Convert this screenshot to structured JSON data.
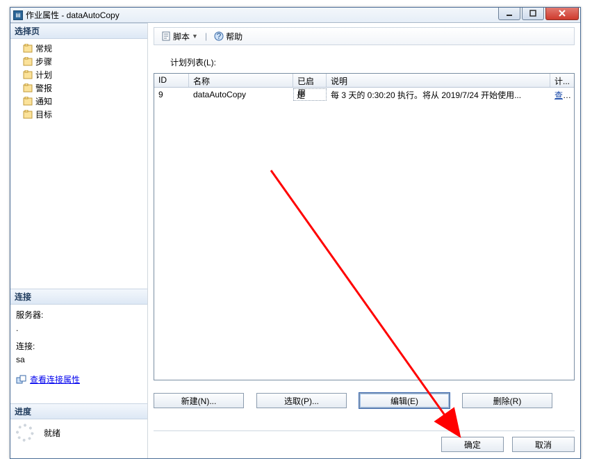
{
  "window": {
    "title": "作业属性 - dataAutoCopy"
  },
  "leftPanel": {
    "selectPageHeader": "选择页",
    "pages": [
      "常规",
      "步骤",
      "计划",
      "警报",
      "通知",
      "目标"
    ],
    "connectionHeader": "连接",
    "serverLabel": "服务器:",
    "serverValue": ".",
    "connectLabel": "连接:",
    "connectValue": "sa",
    "viewConnPropsLink": "查看连接属性",
    "progressHeader": "进度",
    "progressStatus": "就绪"
  },
  "toolbar": {
    "scriptLabel": "脚本",
    "helpLabel": "帮助"
  },
  "main": {
    "scheduleListLabel": "计划列表(L):",
    "columns": {
      "id": "ID",
      "name": "名称",
      "enabled": "已启用",
      "desc": "说明",
      "action": "计..."
    },
    "rows": [
      {
        "id": "9",
        "name": "dataAutoCopy",
        "enabled": "是",
        "desc": "每 3 天的 0:30:20 执行。将从 2019/7/24 开始使用...",
        "action": "查看"
      }
    ],
    "buttons": {
      "new": "新建(N)...",
      "pick": "选取(P)...",
      "edit": "编辑(E)",
      "delete": "删除(R)"
    }
  },
  "footer": {
    "ok": "确定",
    "cancel": "取消"
  }
}
